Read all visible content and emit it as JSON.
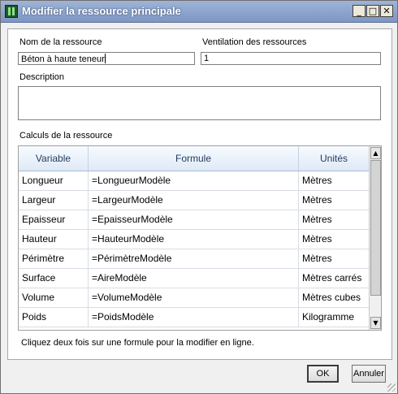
{
  "window": {
    "title": "Modifier la ressource principale",
    "controls": {
      "minimize": "_",
      "maximize": "□",
      "close": "✕"
    }
  },
  "form": {
    "name_label": "Nom de la ressource",
    "name_value": "Béton à haute teneur",
    "ventilation_label": "Ventilation des ressources",
    "ventilation_value": "1",
    "description_label": "Description",
    "description_value": ""
  },
  "grid": {
    "section_label": "Calculs de la ressource",
    "headers": [
      "Variable",
      "Formule",
      "Unités"
    ],
    "rows": [
      {
        "variable": "Longueur",
        "formula": "=LongueurModèle",
        "unit": "Mètres"
      },
      {
        "variable": "Largeur",
        "formula": "=LargeurModèle",
        "unit": "Mètres"
      },
      {
        "variable": "Epaisseur",
        "formula": "=EpaisseurModèle",
        "unit": "Mètres"
      },
      {
        "variable": "Hauteur",
        "formula": "=HauteurModèle",
        "unit": "Mètres"
      },
      {
        "variable": "Périmètre",
        "formula": "=PérimètreModèle",
        "unit": "Mètres"
      },
      {
        "variable": "Surface",
        "formula": "=AireModèle",
        "unit": "Mètres carrés"
      },
      {
        "variable": "Volume",
        "formula": "=VolumeModèle",
        "unit": "Mètres cubes"
      },
      {
        "variable": "Poids",
        "formula": "=PoidsModèle",
        "unit": "Kilogramme"
      }
    ]
  },
  "hint": "Cliquez deux fois sur une formule pour la modifier en ligne.",
  "buttons": {
    "ok": "OK",
    "cancel": "Annuler"
  },
  "icons": {
    "app": "app-icon",
    "scroll_up": "▲",
    "scroll_down": "▼"
  },
  "colors": {
    "titlebar": "#8ea6cf",
    "grid_header": "#e8eff8"
  }
}
